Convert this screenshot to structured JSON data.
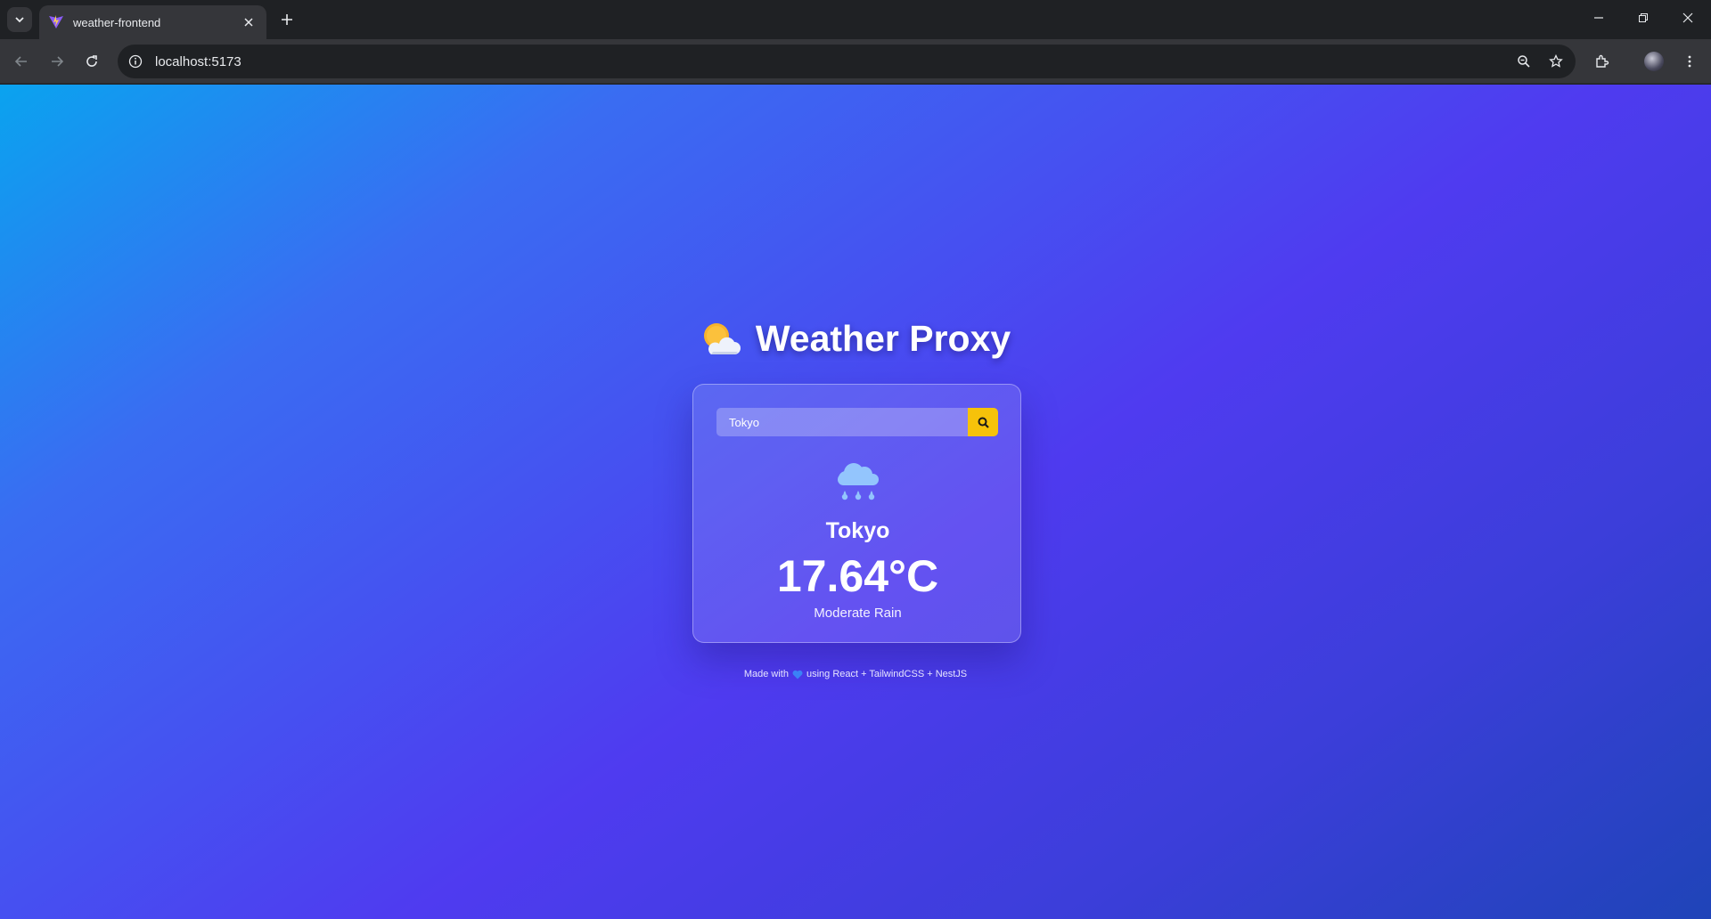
{
  "browser": {
    "tab": {
      "title": "weather-frontend"
    },
    "address_bar": {
      "url": "localhost:5173"
    }
  },
  "app": {
    "title": "Weather Proxy",
    "title_icon": "sun-behind-cloud-emoji",
    "search": {
      "value": "Tokyo",
      "placeholder": "",
      "button_icon": "search-icon"
    },
    "weather": {
      "icon": "rain-cloud-icon",
      "city": "Tokyo",
      "temperature": "17.64°C",
      "description": "Moderate Rain"
    },
    "footer": {
      "prefix": "Made with",
      "heart_icon": "blue-heart-icon",
      "suffix": "using React + TailwindCSS + NestJS"
    }
  },
  "colors": {
    "accent": "#f6c20a",
    "background_start": "#0aa3ef",
    "background_mid": "#4f3bf0",
    "background_end": "#1f44b8"
  }
}
